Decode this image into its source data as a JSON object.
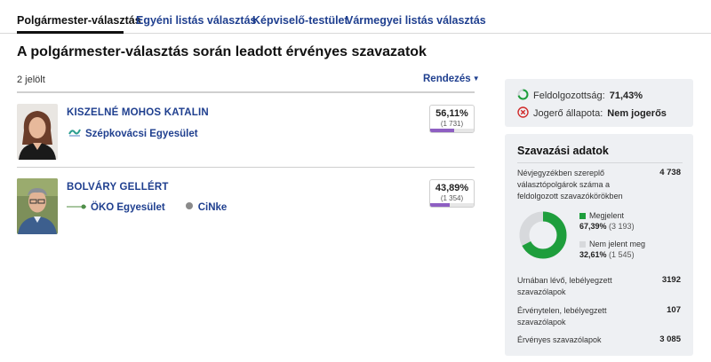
{
  "tabs": [
    {
      "label": "Polgármester-választás",
      "active": true
    },
    {
      "label": "Egyéni listás választás",
      "active": false
    },
    {
      "label": "Képviselő-testület",
      "active": false
    },
    {
      "label": "Vármegyei listás választás",
      "active": false
    }
  ],
  "page_title": "A polgármester-választás során leadott érvényes szavazatok",
  "candidate_count": "2 jelölt",
  "sort_label": "Rendezés",
  "candidates": [
    {
      "name": "KISZELNÉ MOHOS KATALIN",
      "parties": [
        "Szépkovácsi Egyesület"
      ],
      "percent_label": "56,11%",
      "votes_label": "(1 731)",
      "percent": 56.11
    },
    {
      "name": "BOLVÁRY GELLÉRT",
      "parties": [
        "ÖKO Egyesület",
        "CiNke"
      ],
      "percent_label": "43,89%",
      "votes_label": "(1 354)",
      "percent": 43.89
    }
  ],
  "status": {
    "processed_label": "Feldolgozottság:",
    "processed_value": "71,43%",
    "legal_label": "Jogerő állapota:",
    "legal_value": "Nem jogerős"
  },
  "voting_data": {
    "title": "Szavazási adatok",
    "registered_label": "Névjegyzékben szereplő választópolgárok száma a feldolgozott szavazókörökben",
    "registered_value": "4 738",
    "present_label": "Megjelent",
    "present_pct": "67,39%",
    "present_count": "(3 193)",
    "absent_label": "Nem jelent meg",
    "absent_pct": "32,61%",
    "absent_count": "(1 545)",
    "present_fraction": 0.6739,
    "ballots_label": "Urnában lévő, lebélyegzett szavazólapok",
    "ballots_value": "3192",
    "invalid_label": "Érvénytelen, lebélyegzett szavazólapok",
    "invalid_value": "107",
    "valid_label": "Érvényes szavazólapok",
    "valid_value": "3 085"
  },
  "colors": {
    "accent_blue": "#1f3f8f",
    "bar_purple": "#8e5fc2",
    "present_green": "#1e9e3c",
    "absent_gray": "#d7d9dc",
    "error_red": "#d12b2b"
  }
}
